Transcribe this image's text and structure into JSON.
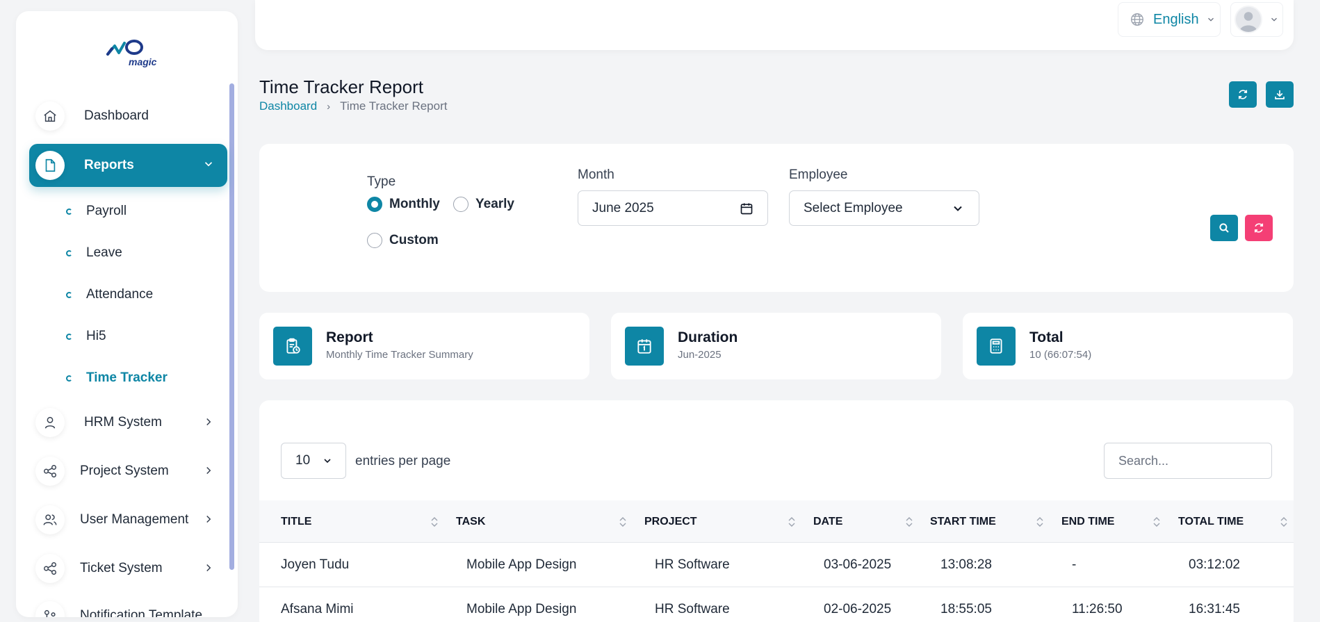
{
  "app": {
    "logo_text": "magic"
  },
  "sidebar": {
    "items": [
      {
        "label": "Dashboard",
        "icon": "home-icon"
      },
      {
        "label": "Reports",
        "icon": "document-icon",
        "active": true
      },
      {
        "label": "HRM System",
        "icon": "user-icon"
      },
      {
        "label": "Project System",
        "icon": "share-icon"
      },
      {
        "label": "User Management",
        "icon": "users-icon"
      },
      {
        "label": "Ticket System",
        "icon": "share-icon"
      },
      {
        "label": "Notification Template",
        "icon": "template-icon"
      }
    ],
    "report_subitems": [
      {
        "label": "Payroll"
      },
      {
        "label": "Leave"
      },
      {
        "label": "Attendance"
      },
      {
        "label": "Hi5"
      },
      {
        "label": "Time Tracker",
        "active": true
      }
    ]
  },
  "header": {
    "language": "English"
  },
  "page": {
    "title": "Time Tracker Report",
    "breadcrumb": [
      "Dashboard",
      "Time Tracker Report"
    ]
  },
  "filters": {
    "type_label": "Type",
    "type_options": [
      "Monthly",
      "Yearly",
      "Custom"
    ],
    "type_selected": "Monthly",
    "month_label": "Month",
    "month_value": "June 2025",
    "employee_label": "Employee",
    "employee_value": "Select Employee"
  },
  "stats": [
    {
      "title": "Report",
      "subtitle": "Monthly Time Tracker Summary",
      "icon": "clipboard-icon"
    },
    {
      "title": "Duration",
      "subtitle": "Jun-2025",
      "icon": "calendar-icon"
    },
    {
      "title": "Total",
      "subtitle": "10 (66:07:54)",
      "icon": "calculator-icon"
    }
  ],
  "table": {
    "page_size": "10",
    "entries_label": "entries per page",
    "search_placeholder": "Search...",
    "columns": [
      "TITLE",
      "TASK",
      "PROJECT",
      "DATE",
      "START TIME",
      "END TIME",
      "TOTAL TIME"
    ],
    "rows": [
      [
        "Joyen Tudu",
        "Mobile App Design",
        "HR Software",
        "03-06-2025",
        "13:08:28",
        "-",
        "03:12:02"
      ],
      [
        "Afsana Mimi",
        "Mobile App Design",
        "HR Software",
        "02-06-2025",
        "18:55:05",
        "11:26:50",
        "16:31:45"
      ]
    ]
  },
  "colors": {
    "primary": "#0e86a5",
    "danger": "#f43f75",
    "scrollbar": "#a3aee0"
  }
}
